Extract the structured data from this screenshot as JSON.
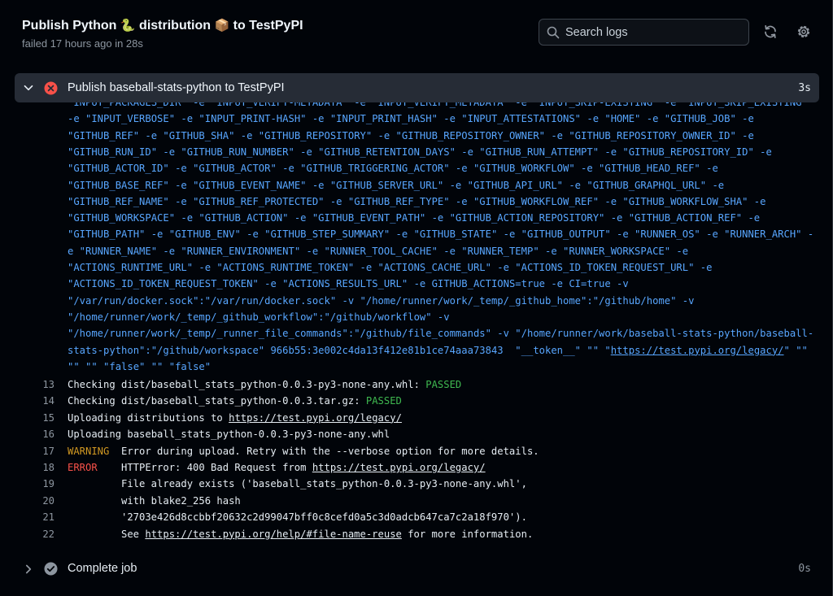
{
  "header": {
    "title_prefix": "Publish Python",
    "title_emoji1": "🐍",
    "title_mid": "distribution",
    "title_emoji2": "📦",
    "title_suffix": "to TestPyPI",
    "subtitle": "failed 17 hours ago in 28s",
    "search_placeholder": "Search logs",
    "refresh_icon": "sync-icon",
    "settings_icon": "gear-icon"
  },
  "step": {
    "name": "Publish baseball-stats-python to TestPyPI",
    "duration": "3s",
    "status": "failed",
    "status_color": "#f85149"
  },
  "wrapped_lines": [
    "\"INPUT_PACKAGES_DIR\" -e \"INPUT_VERIFY-METADATA\" -e \"INPUT_VERIFY_METADATA\" -e \"INPUT_SKIP-EXISTING\" -e \"INPUT_SKIP_EXISTING\"",
    "-e \"INPUT_VERBOSE\" -e \"INPUT_PRINT-HASH\" -e \"INPUT_PRINT_HASH\" -e \"INPUT_ATTESTATIONS\" -e \"HOME\" -e \"GITHUB_JOB\" -e",
    "\"GITHUB_REF\" -e \"GITHUB_SHA\" -e \"GITHUB_REPOSITORY\" -e \"GITHUB_REPOSITORY_OWNER\" -e \"GITHUB_REPOSITORY_OWNER_ID\" -e",
    "\"GITHUB_RUN_ID\" -e \"GITHUB_RUN_NUMBER\" -e \"GITHUB_RETENTION_DAYS\" -e \"GITHUB_RUN_ATTEMPT\" -e \"GITHUB_REPOSITORY_ID\" -e",
    "\"GITHUB_ACTOR_ID\" -e \"GITHUB_ACTOR\" -e \"GITHUB_TRIGGERING_ACTOR\" -e \"GITHUB_WORKFLOW\" -e \"GITHUB_HEAD_REF\" -e",
    "\"GITHUB_BASE_REF\" -e \"GITHUB_EVENT_NAME\" -e \"GITHUB_SERVER_URL\" -e \"GITHUB_API_URL\" -e \"GITHUB_GRAPHQL_URL\" -e",
    "\"GITHUB_REF_NAME\" -e \"GITHUB_REF_PROTECTED\" -e \"GITHUB_REF_TYPE\" -e \"GITHUB_WORKFLOW_REF\" -e \"GITHUB_WORKFLOW_SHA\" -e",
    "\"GITHUB_WORKSPACE\" -e \"GITHUB_ACTION\" -e \"GITHUB_EVENT_PATH\" -e \"GITHUB_ACTION_REPOSITORY\" -e \"GITHUB_ACTION_REF\" -e",
    "\"GITHUB_PATH\" -e \"GITHUB_ENV\" -e \"GITHUB_STEP_SUMMARY\" -e \"GITHUB_STATE\" -e \"GITHUB_OUTPUT\" -e \"RUNNER_OS\" -e \"RUNNER_ARCH\" -",
    "e \"RUNNER_NAME\" -e \"RUNNER_ENVIRONMENT\" -e \"RUNNER_TOOL_CACHE\" -e \"RUNNER_TEMP\" -e \"RUNNER_WORKSPACE\" -e",
    "\"ACTIONS_RUNTIME_URL\" -e \"ACTIONS_RUNTIME_TOKEN\" -e \"ACTIONS_CACHE_URL\" -e \"ACTIONS_ID_TOKEN_REQUEST_URL\" -e",
    "\"ACTIONS_ID_TOKEN_REQUEST_TOKEN\" -e \"ACTIONS_RESULTS_URL\" -e GITHUB_ACTIONS=true -e CI=true -v",
    "\"/var/run/docker.sock\":\"/var/run/docker.sock\" -v \"/home/runner/work/_temp/_github_home\":\"/github/home\" -v",
    "\"/home/runner/work/_temp/_github_workflow\":\"/github/workflow\" -v",
    "\"/home/runner/work/_temp/_runner_file_commands\":\"/github/file_commands\" -v \"/home/runner/work/baseball-stats-python/baseball-",
    "stats-python\":\"/github/workspace\" 966b55:3e002c4da13f412e81b1ce74aaa73843  \"__token__\" \"\" \"",
    "\"\" \"\" \"false\" \"\" \"false\""
  ],
  "wrapped_link": {
    "url": "https://test.pypi.org/legacy/",
    "after": "\" \"\""
  },
  "log_lines": [
    {
      "n": "13",
      "before": "Checking dist/baseball_stats_python-0.0.3-py3-none-any.whl: ",
      "status": "PASSED"
    },
    {
      "n": "14",
      "before": "Checking dist/baseball_stats_python-0.0.3.tar.gz: ",
      "status": "PASSED"
    },
    {
      "n": "15",
      "before": "Uploading distributions to ",
      "link": "https://test.pypi.org/legacy/"
    },
    {
      "n": "16",
      "before": "Uploading baseball_stats_python-0.0.3-py3-none-any.whl"
    },
    {
      "n": "17",
      "level": "WARNING",
      "msg": "Error during upload. Retry with the --verbose option for more details."
    },
    {
      "n": "18",
      "level": "ERROR",
      "msg": "HTTPError: 400 Bad Request from ",
      "link": "https://test.pypi.org/legacy/"
    },
    {
      "n": "19",
      "msg": "File already exists ('baseball_stats_python-0.0.3-py3-none-any.whl',"
    },
    {
      "n": "20",
      "msg": "with blake2_256 hash"
    },
    {
      "n": "21",
      "msg": "'2703e426d8ccbbf20632c2d99047bff0c8cefd0a5c3d0adcb647ca7c2a18f970')."
    },
    {
      "n": "22",
      "msg": "See ",
      "link": "https://test.pypi.org/help/#file-name-reuse",
      "after": " for more information."
    }
  ],
  "step2": {
    "name": "Complete job",
    "duration": "0s",
    "status": "success",
    "status_color": "#8d96a0"
  }
}
